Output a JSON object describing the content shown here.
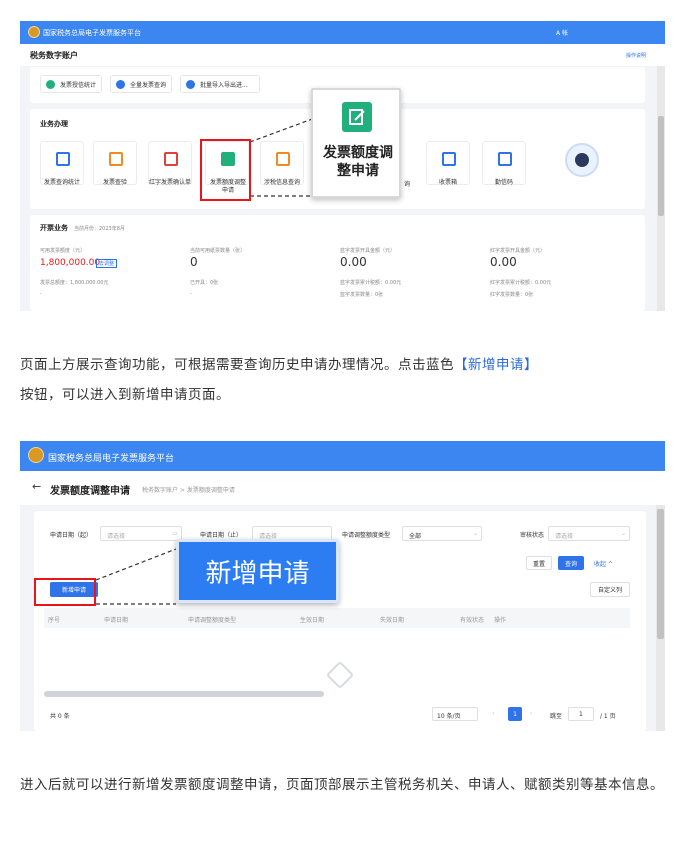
{
  "screen1": {
    "platform_title": "国家税务总局电子发票服务平台",
    "user_label": "A 帐",
    "page_title": "税务数字账户",
    "top_right_link": "操作说明",
    "quick_actions": [
      "发票授信统计",
      "全量发票查询",
      "批量导入导出进..."
    ],
    "section_title": "业务办理",
    "tiles": [
      {
        "label": "发票查询统计",
        "icon": "doc-icon",
        "color": "#2e73e8"
      },
      {
        "label": "发票查验",
        "icon": "invoice-check-icon",
        "color": "#f08a24"
      },
      {
        "label": "红字发票确认单",
        "icon": "red-invoice-icon",
        "color": "#e0413a"
      },
      {
        "label": "发票额度调整申请",
        "icon": "edit-icon",
        "color": "#21b07b"
      },
      {
        "label": "涉税信息查询",
        "icon": "tax-info-icon",
        "color": "#f08a24"
      },
      {
        "label": "收票箱",
        "icon": "inbox-icon",
        "color": "#2e73e8"
      },
      {
        "label": "勤信码",
        "icon": "qrcode-icon",
        "color": "#2e73e8"
      }
    ],
    "kaipiao_title": "开票业务",
    "kaipiao_period": "当前月份：2023年8月",
    "stats": [
      {
        "label": "可用发票额度（元）",
        "value": "1,800,000.00",
        "badge": "去调整",
        "sub1": "发票总额度：1,800,000.00元",
        "sub2": "-"
      },
      {
        "label": "当前可用纸票数量（张）",
        "value": "0",
        "sub1": "已开具：0张",
        "sub2": "-"
      },
      {
        "label": "蓝字发票开具金额（元）",
        "value": "0.00",
        "sub1": "蓝字发票累计税额：0.00元",
        "sub2": "蓝字发票数量：0张"
      },
      {
        "label": "红字发票开具金额（元）",
        "value": "0.00",
        "sub1": "红字发票累计税额：0.00元",
        "sub2": "红字发票数量：0张"
      }
    ],
    "callout_label": "发票额度调整申请",
    "partial_label": "询"
  },
  "caption1": {
    "part1": "页面上方展示查询功能，可根据需要查询历史申请办理情况。点击蓝色",
    "highlight": "【新增申请】",
    "part2": "按钮，可以进入到新增申请页面。"
  },
  "screen2": {
    "platform_title": "国家税务总局电子发票服务平台",
    "back_arrow": "←",
    "page_title": "发票额度调整申请",
    "breadcrumb": "税务数字账户 > 发票额度调整申请",
    "filters": [
      {
        "label": "申请日期（起）",
        "placeholder": "请选择"
      },
      {
        "label": "申请日期（止）",
        "placeholder": "请选择"
      },
      {
        "label": "申请调整额度类型",
        "value": "全部"
      },
      {
        "label": "审核状态",
        "placeholder": "请选择"
      }
    ],
    "reset_btn": "重置",
    "query_btn": "查询",
    "collapse_link": "收起 ^",
    "new_btn": "新增申请",
    "custom_cols_btn": "自定义列",
    "columns": [
      "序号",
      "申请日期",
      "申请调整额度类型",
      "生效日期",
      "失效日期",
      "有效状态",
      "操作"
    ],
    "total": "共 0 条",
    "page_size": "10 条/页",
    "current_page": "1",
    "goto_label": "跳至",
    "goto_value": "1",
    "pages_total": "/ 1 页",
    "callout_label": "新增申请"
  },
  "caption2": {
    "text": "进入后就可以进行新增发票额度调整申请，页面顶部展示主管税务机关、申请人、赋额类别等基本信息。"
  }
}
